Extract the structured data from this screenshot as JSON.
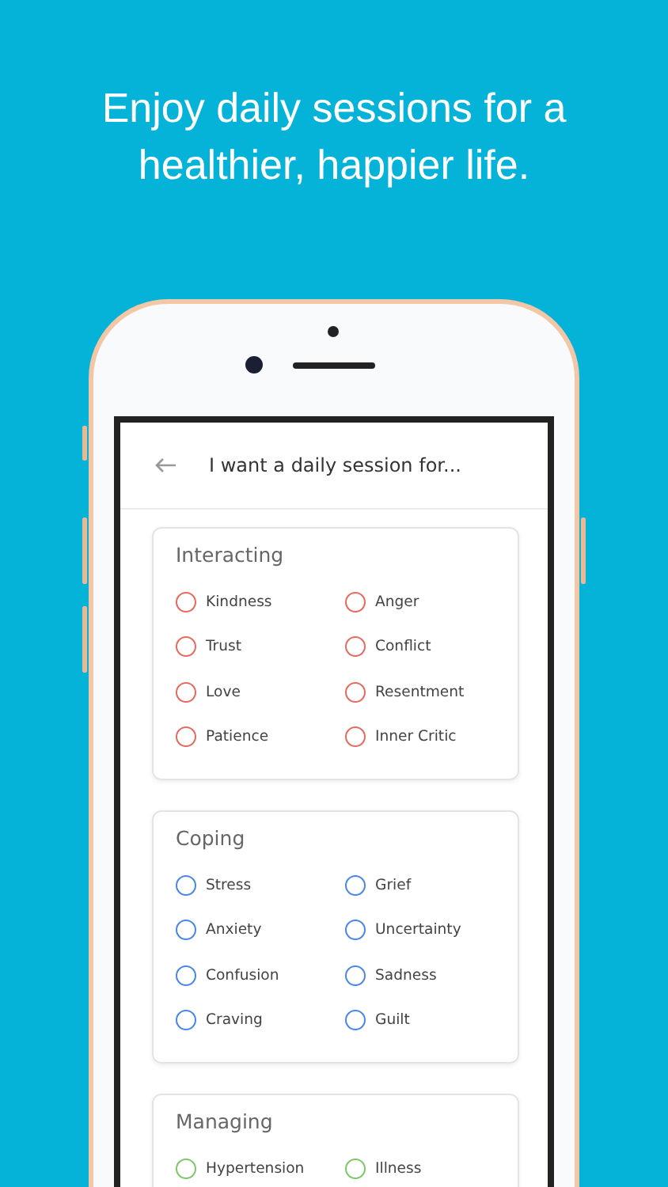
{
  "headline": "Enjoy daily sessions for a healthier, happier life.",
  "screen": {
    "title": "I want a daily session for..."
  },
  "sections": [
    {
      "title": "Interacting",
      "color": "#e8695e",
      "options": [
        {
          "label": "Kindness",
          "selected": false
        },
        {
          "label": "Anger",
          "selected": false
        },
        {
          "label": "Trust",
          "selected": false
        },
        {
          "label": "Conflict",
          "selected": false
        },
        {
          "label": "Love",
          "selected": false
        },
        {
          "label": "Resentment",
          "selected": false
        },
        {
          "label": "Patience",
          "selected": false
        },
        {
          "label": "Inner Critic",
          "selected": false
        }
      ]
    },
    {
      "title": "Coping",
      "color": "#4a86e8",
      "options": [
        {
          "label": "Stress",
          "selected": false
        },
        {
          "label": "Grief",
          "selected": false
        },
        {
          "label": "Anxiety",
          "selected": false
        },
        {
          "label": "Uncertainty",
          "selected": false
        },
        {
          "label": "Confusion",
          "selected": false
        },
        {
          "label": "Sadness",
          "selected": false
        },
        {
          "label": "Craving",
          "selected": false
        },
        {
          "label": "Guilt",
          "selected": false
        }
      ]
    },
    {
      "title": "Managing",
      "color": "#7dc76a",
      "options": [
        {
          "label": "Hypertension",
          "selected": false
        },
        {
          "label": "Illness",
          "selected": false
        }
      ]
    }
  ]
}
